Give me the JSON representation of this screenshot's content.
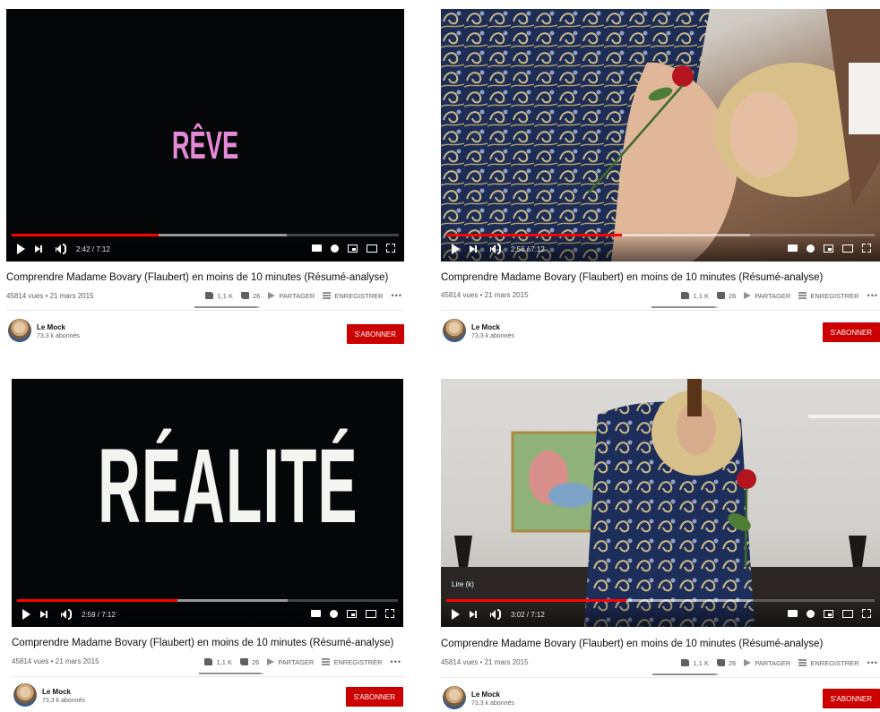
{
  "colors": {
    "accent_red": "#cc0000",
    "progress_red": "#ff0000",
    "reve_pink": "#e58ad6",
    "realite_white": "#f4f4f0"
  },
  "panels": [
    {
      "overlay_word": "RÊVE",
      "time": "2:42 / 7:12",
      "progress": 0.38,
      "buffered": 0.71,
      "tooltip": "",
      "title": "Comprendre Madame Bovary (Flaubert) en moins de 10 minutes (Résumé-analyse)",
      "meta": "45814 vues • 21 mars 2015",
      "likes": "1,1 K",
      "dislikes": "26",
      "share": "PARTAGER",
      "save": "ENREGISTRER",
      "channel": "Le Mock",
      "subscribers": "73,3 k abonnés",
      "subscribe": "S'ABONNER"
    },
    {
      "overlay_word": "",
      "time": "2:56 / 7:12",
      "progress": 0.41,
      "buffered": 0.71,
      "tooltip": "",
      "title": "Comprendre Madame Bovary (Flaubert) en moins de 10 minutes (Résumé-analyse)",
      "meta": "45814 vues • 21 mars 2015",
      "likes": "1,1 K",
      "dislikes": "26",
      "share": "PARTAGER",
      "save": "ENREGISTRER",
      "channel": "Le Mock",
      "subscribers": "73,3 k abonnés",
      "subscribe": "S'ABONNER"
    },
    {
      "overlay_word": "RÉALITÉ",
      "time": "2:59 / 7:12",
      "progress": 0.42,
      "buffered": 0.71,
      "tooltip": "",
      "title": "Comprendre Madame Bovary (Flaubert) en moins de 10 minutes (Résumé-analyse)",
      "meta": "45814 vues • 21 mars 2015",
      "likes": "1,1 K",
      "dislikes": "26",
      "share": "PARTAGER",
      "save": "ENREGISTRER",
      "channel": "Le Mock",
      "subscribers": "73,3 k abonnés",
      "subscribe": "S'ABONNER"
    },
    {
      "overlay_word": "",
      "time": "3:02 / 7:12",
      "progress": 0.42,
      "buffered": 0.71,
      "tooltip": "Lire (k)",
      "title": "Comprendre Madame Bovary (Flaubert) en moins de 10 minutes (Résumé-analyse)",
      "meta": "45814 vues • 21 mars 2015",
      "likes": "1,1 K",
      "dislikes": "26",
      "share": "PARTAGER",
      "save": "ENREGISTRER",
      "channel": "Le Mock",
      "subscribers": "73,3 k abonnés",
      "subscribe": "S'ABONNER"
    }
  ]
}
